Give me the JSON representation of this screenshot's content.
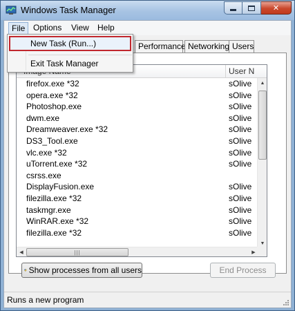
{
  "window": {
    "title": "Windows Task Manager"
  },
  "menu": {
    "file": "File",
    "options": "Options",
    "view": "View",
    "help": "Help"
  },
  "file_menu": {
    "new_task": "New Task (Run...)",
    "exit": "Exit Task Manager"
  },
  "tabs": {
    "performance": "Performance",
    "networking": "Networking",
    "users": "Users"
  },
  "columns": {
    "image_name": "Image Name",
    "user_name": "User N"
  },
  "processes": [
    {
      "image": "firefox.exe *32",
      "user": "sOlive"
    },
    {
      "image": "opera.exe *32",
      "user": "sOlive"
    },
    {
      "image": "Photoshop.exe",
      "user": "sOlive"
    },
    {
      "image": "dwm.exe",
      "user": "sOlive"
    },
    {
      "image": "Dreamweaver.exe *32",
      "user": "sOlive"
    },
    {
      "image": "DS3_Tool.exe",
      "user": "sOlive"
    },
    {
      "image": "vlc.exe *32",
      "user": "sOlive"
    },
    {
      "image": "uTorrent.exe *32",
      "user": "sOlive"
    },
    {
      "image": "csrss.exe",
      "user": ""
    },
    {
      "image": "DisplayFusion.exe",
      "user": "sOlive"
    },
    {
      "image": "filezilla.exe *32",
      "user": "sOlive"
    },
    {
      "image": "taskmgr.exe",
      "user": "sOlive"
    },
    {
      "image": "WinRAR.exe *32",
      "user": "sOlive"
    },
    {
      "image": "filezilla.exe *32",
      "user": "sOlive"
    }
  ],
  "buttons": {
    "show_all": "Show processes from all users",
    "end_process": "End Process"
  },
  "status": {
    "text": "Runs a new program"
  },
  "colors": {
    "highlight_border": "#c1272d",
    "title_bar": "#a7c3e3",
    "close_button": "#c9472b"
  }
}
